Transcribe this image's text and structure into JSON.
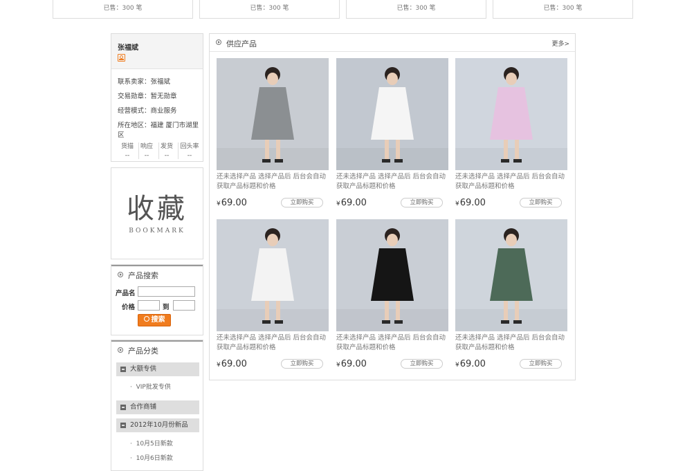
{
  "top_strip": {
    "sold_label": "已售：300 笔",
    "boxes": 4
  },
  "seller": {
    "name": "张福斌",
    "contact": "联系卖家：张福斌",
    "medal": "交易勋章：暂无勋章",
    "mode": "经营模式：商业服务",
    "region": "所在地区：福建 厦门市湖里区",
    "stats": [
      {
        "label": "货描",
        "value": "--"
      },
      {
        "label": "响应",
        "value": "--"
      },
      {
        "label": "发货",
        "value": "--"
      },
      {
        "label": "回头率",
        "value": "--"
      }
    ]
  },
  "bookmark": {
    "title": "收藏",
    "subtitle": "BOOKMARK"
  },
  "search": {
    "title": "产品搜索",
    "name_label": "产品名",
    "price_label": "价格",
    "to_label": "到",
    "button": "搜索"
  },
  "categories": {
    "title": "产品分类",
    "groups": [
      {
        "label": "大额专供",
        "items": [
          "VIP批发专供"
        ]
      },
      {
        "label": "合作商铺",
        "items": []
      },
      {
        "label": "2012年10月份新品",
        "items": [
          "10月5日新款",
          "10月6日新款"
        ]
      }
    ]
  },
  "products_panel": {
    "title": "供应产品",
    "more": "更多>",
    "products": [
      {
        "title": "还未选择产品  选择产品后  后台会自动获取产品标题和价格",
        "currency": "¥",
        "price": "69.00",
        "buy": "立即购买",
        "dress": "#8b8f92",
        "bg": "#c8ccd2"
      },
      {
        "title": "还未选择产品  选择产品后  后台会自动获取产品标题和价格",
        "currency": "¥",
        "price": "69.00",
        "buy": "立即购买",
        "dress": "#f5f5f5",
        "bg": "#c2c8d0"
      },
      {
        "title": "还未选择产品  选择产品后  后台会自动获取产品标题和价格",
        "currency": "¥",
        "price": "69.00",
        "buy": "立即购买",
        "dress": "#e6c2e0",
        "bg": "#d0d6de"
      },
      {
        "title": "还未选择产品  选择产品后  后台会自动获取产品标题和价格",
        "currency": "¥",
        "price": "69.00",
        "buy": "立即购买",
        "dress": "#f3f3f3",
        "bg": "#ccd1d8"
      },
      {
        "title": "还未选择产品  选择产品后  后台会自动获取产品标题和价格",
        "currency": "¥",
        "price": "69.00",
        "buy": "立即购买",
        "dress": "#151515",
        "bg": "#c9ced5"
      },
      {
        "title": "还未选择产品  选择产品后  后台会自动获取产品标题和价格",
        "currency": "¥",
        "price": "69.00",
        "buy": "立即购买",
        "dress": "#4d6a58",
        "bg": "#cfd5dc"
      }
    ]
  },
  "colors": {
    "accent": "#f07c1e",
    "border": "#dcdcdc",
    "header_bar": "#dedede"
  }
}
